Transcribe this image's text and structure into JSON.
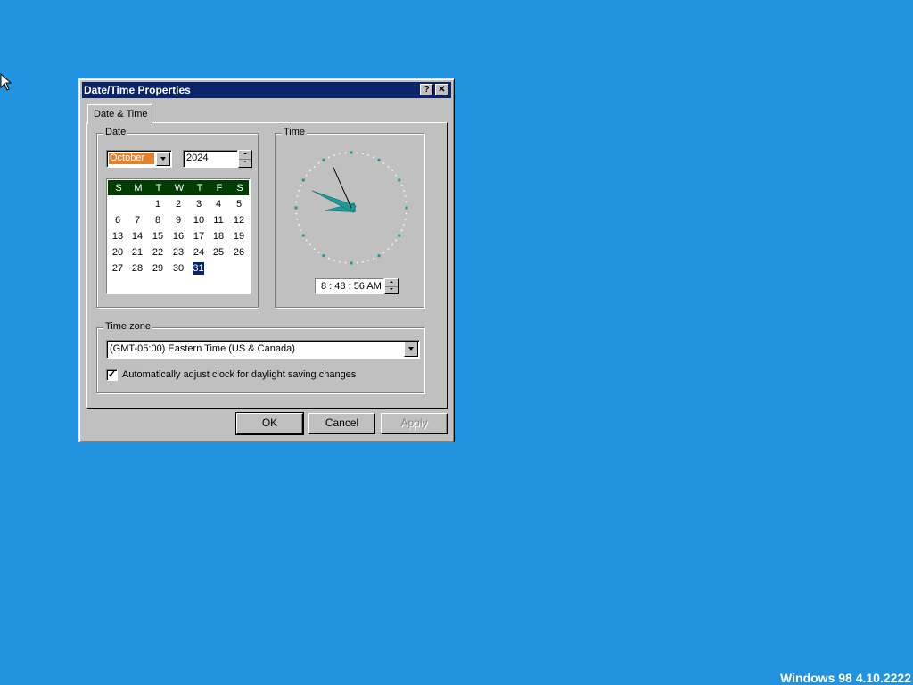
{
  "window": {
    "title": "Date/Time Properties",
    "help_label": "?",
    "close_label": "✕"
  },
  "tab": {
    "label": "Date & Time"
  },
  "date_group": {
    "label": "Date",
    "month": "October",
    "year": "2024",
    "weekday_headers": [
      "S",
      "M",
      "T",
      "W",
      "T",
      "F",
      "S"
    ],
    "weeks": [
      [
        "",
        "",
        "1",
        "2",
        "3",
        "4",
        "5"
      ],
      [
        "6",
        "7",
        "8",
        "9",
        "10",
        "11",
        "12"
      ],
      [
        "13",
        "14",
        "15",
        "16",
        "17",
        "18",
        "19"
      ],
      [
        "20",
        "21",
        "22",
        "23",
        "24",
        "25",
        "26"
      ],
      [
        "27",
        "28",
        "29",
        "30",
        "31",
        "",
        ""
      ]
    ],
    "selected_day": "31"
  },
  "time_group": {
    "label": "Time",
    "time_value": "8 : 48 : 56 AM",
    "clock": {
      "hour": 8,
      "minute": 48,
      "second": 56
    }
  },
  "timezone_group": {
    "label": "Time zone",
    "selected": "(GMT-05:00) Eastern Time (US & Canada)",
    "daylight_checkbox_label": "Automatically adjust clock for daylight saving changes",
    "daylight_checked": true
  },
  "buttons": {
    "ok": "OK",
    "cancel": "Cancel",
    "apply": "Apply"
  },
  "desktop": {
    "version_text": "Windows 98 4.10.2222"
  },
  "colors": {
    "desktop": "#2293de",
    "titlebar": "#0a246a",
    "calendar_header": "#003c00",
    "month_highlight": "#e0822e",
    "clock_hands": "#1a9a9a"
  }
}
